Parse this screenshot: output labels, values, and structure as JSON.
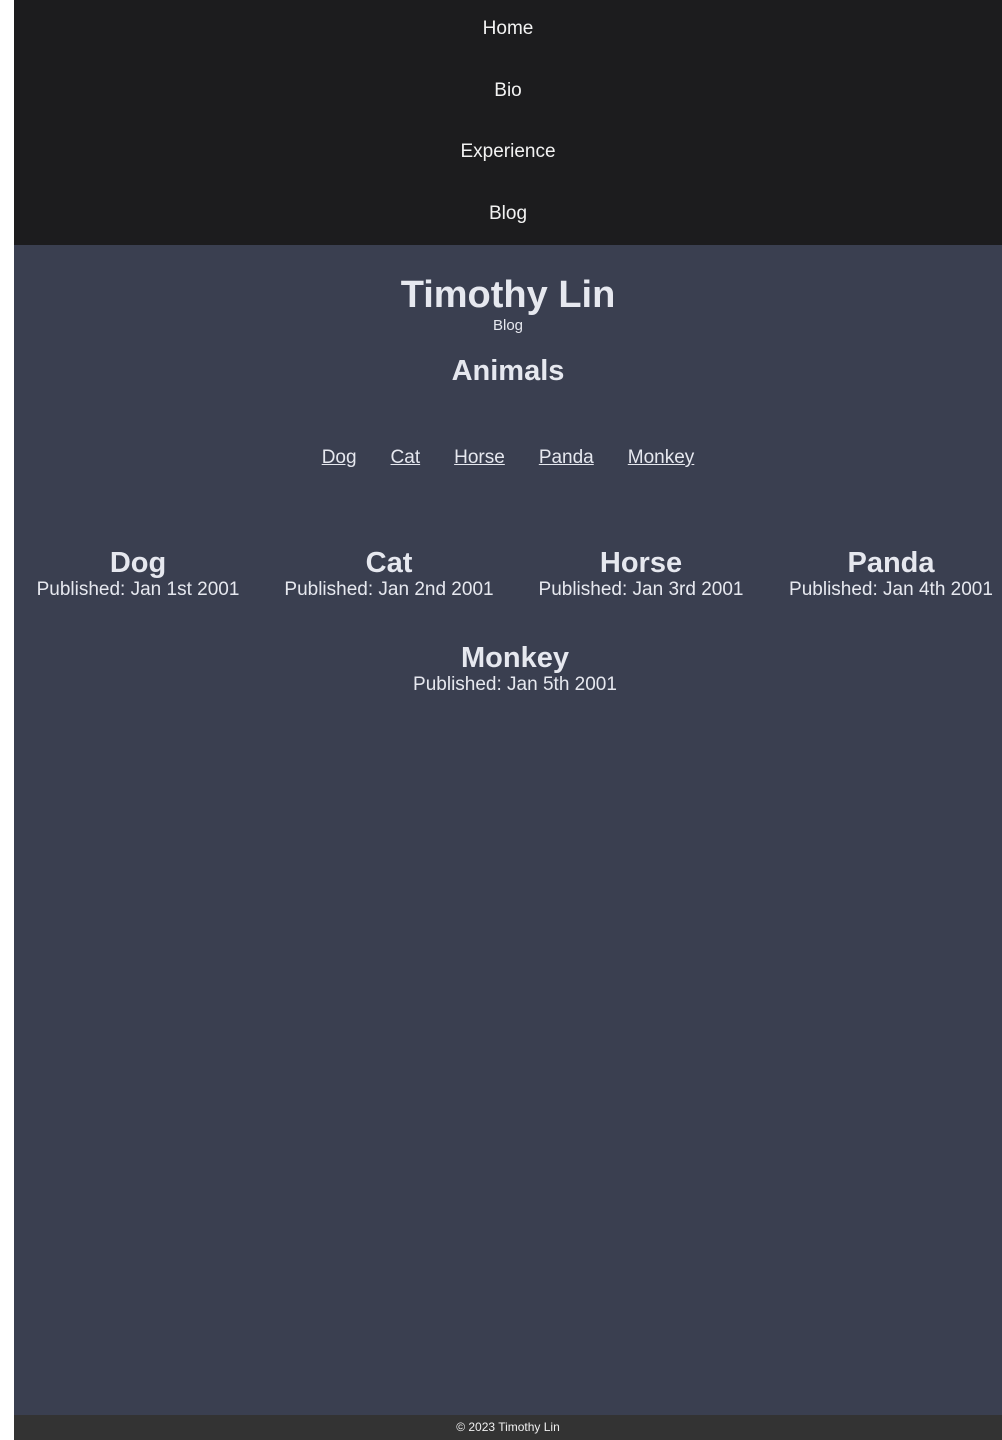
{
  "nav": {
    "items": [
      {
        "label": "Home"
      },
      {
        "label": "Bio"
      },
      {
        "label": "Experience"
      },
      {
        "label": "Blog"
      }
    ]
  },
  "header": {
    "title": "Timothy Lin",
    "subtitle": "Blog"
  },
  "section": {
    "title": "Animals",
    "links": [
      "Dog",
      "Cat",
      "Horse",
      "Panda",
      "Monkey"
    ]
  },
  "posts": [
    {
      "title": "Dog",
      "date": "Published: Jan 1st 2001"
    },
    {
      "title": "Cat",
      "date": "Published: Jan 2nd 2001"
    },
    {
      "title": "Horse",
      "date": "Published: Jan 3rd 2001"
    },
    {
      "title": "Panda",
      "date": "Published: Jan 4th 2001"
    },
    {
      "title": "Monkey",
      "date": "Published: Jan 5th 2001"
    }
  ],
  "footer": {
    "text": "© 2023 Timothy Lin"
  },
  "colors": {
    "nav_background": "#1c1c1e",
    "page_background": "#3a3f50",
    "footer_background": "#333333",
    "text": "#e6e8ef"
  }
}
